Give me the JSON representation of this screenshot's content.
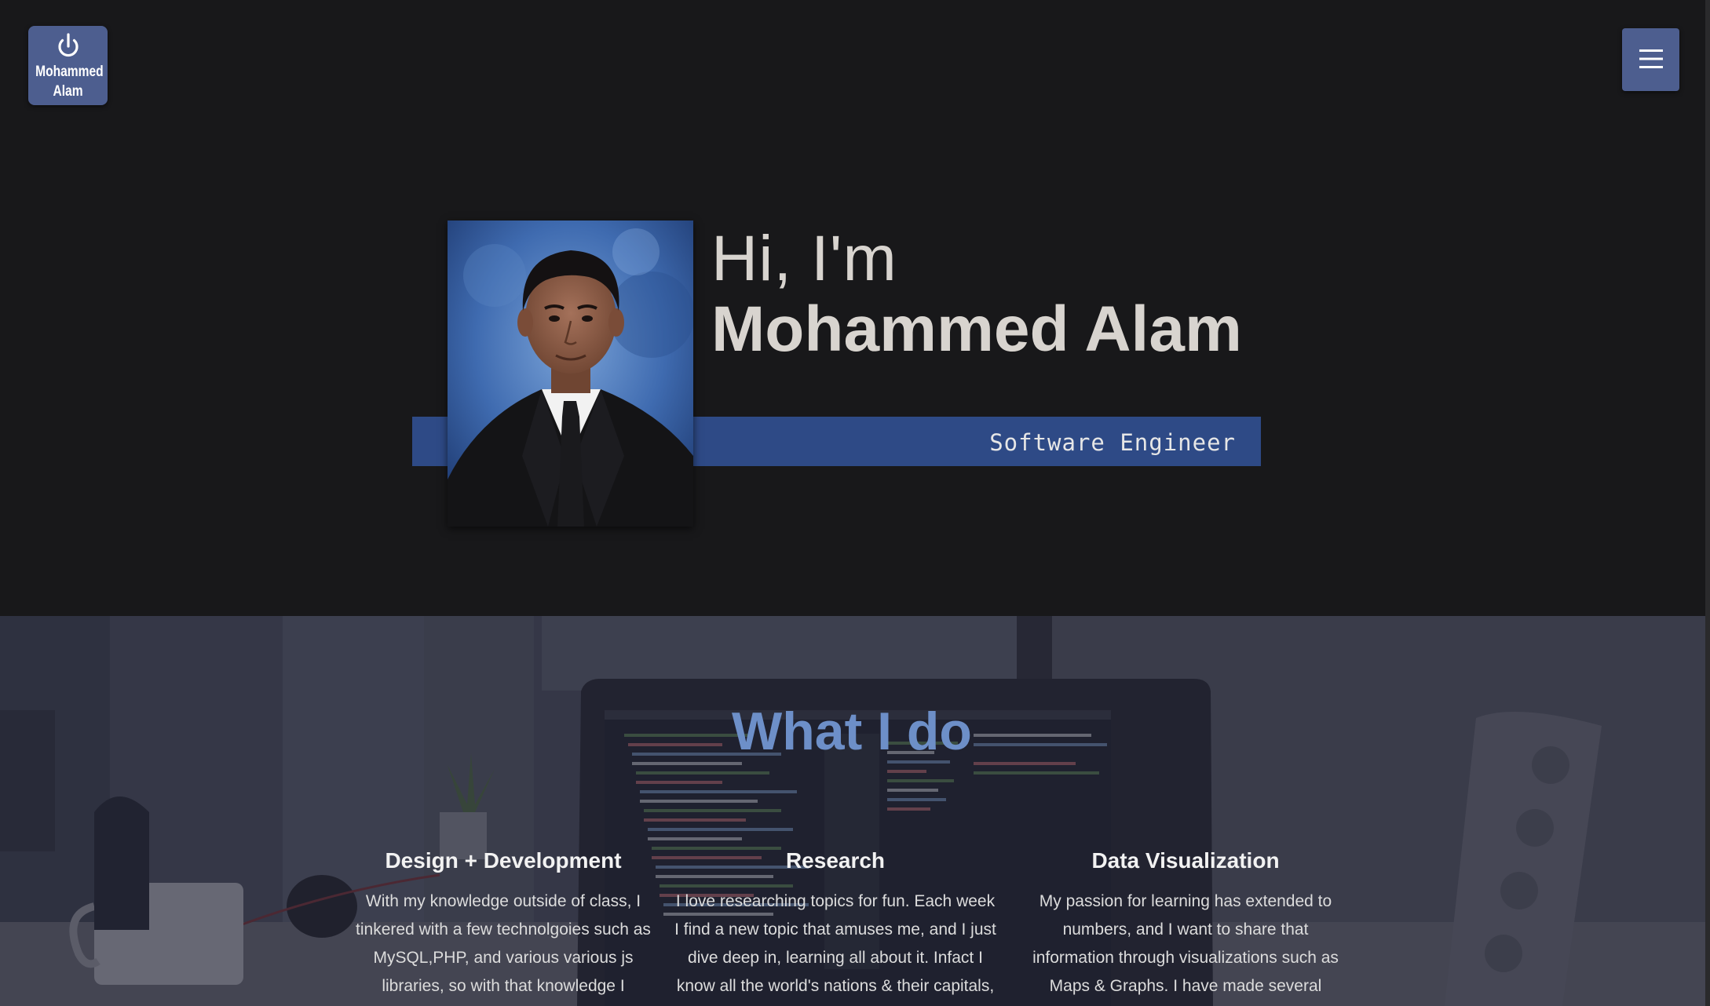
{
  "nav": {
    "logo_text": "Mohammed\nAlam",
    "logo_icon": "power-icon",
    "menu_icon": "hamburger-icon"
  },
  "hero": {
    "greeting": "Hi, I'm",
    "name": "Mohammed Alam",
    "role": "Software Engineer",
    "portrait_alt": "Portrait photo"
  },
  "what_i_do": {
    "title": "What I do",
    "services": [
      {
        "title": "Design + Development",
        "text": "With my knowledge outside of class, I tinkered with a few technolgoies such as MySQL,PHP, and various various js libraries, so with that knowledge I"
      },
      {
        "title": "Research",
        "text": "I love researching topics for fun. Each week I find a new topic that amuses me, and I just dive deep in, learning all about it. Infact I know all the world's nations & their capitals,"
      },
      {
        "title": "Data Visualization",
        "text": "My passion for learning has extended to numbers, and I want to share that information through visualizations such as Maps & Graphs. I have made several maps"
      }
    ]
  },
  "colors": {
    "background": "#18181a",
    "accent": "#4d5e8f",
    "band": "#2e4a86",
    "section_title": "#6d8fc8",
    "hero_text": "#d8d4cf"
  }
}
